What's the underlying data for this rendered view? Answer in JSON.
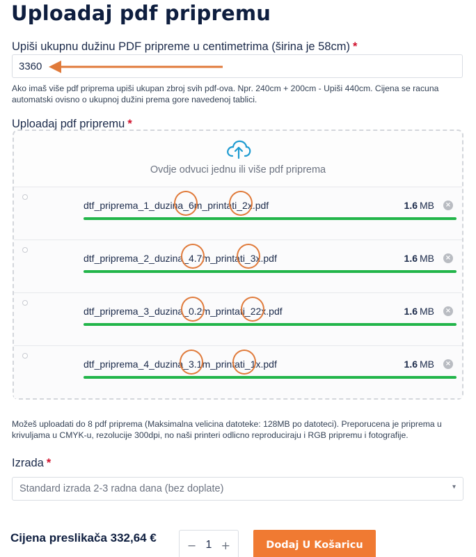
{
  "page_title": "Uploadaj pdf pripremu",
  "length_field": {
    "label": "Upiši ukupnu dužinu PDF pripreme u centimetrima (širina je 58cm)",
    "required_mark": "*",
    "value": "3360",
    "help": "Ako imaš više pdf priprema upiši ukupan zbroj svih pdf-ova. Npr. 240cm + 200cm - Upiši 440cm. Cijena se racuna automatski ovisno o ukupnoj dužini prema gore navedenoj tablici."
  },
  "upload_field": {
    "label": "Uploadaj pdf pripremu",
    "required_mark": "*",
    "dropzone_text": "Ovdje odvuci jednu ili više pdf priprema",
    "files": [
      {
        "name": "dtf_priprema_1_duzina_6m_printati_2x.pdf",
        "size_value": "1.6",
        "size_unit": "MB",
        "progress": 1.0
      },
      {
        "name": "dtf_priprema_2_duzina_4.7m_printati_3x.pdf",
        "size_value": "1.6",
        "size_unit": "MB",
        "progress": 1.0
      },
      {
        "name": "dtf_priprema_3_duzina_0.2m_printati_22x.pdf",
        "size_value": "1.6",
        "size_unit": "MB",
        "progress": 1.0
      },
      {
        "name": "dtf_priprema_4_duzina_3.1m_printati_1x.pdf",
        "size_value": "1.6",
        "size_unit": "MB",
        "progress": 1.0
      }
    ],
    "help": "Možeš uploadati do 8 pdf priprema (Maksimalna velicina datoteke: 128MB po datoteci). Preporucena je priprema u krivuljama u CMYK-u, rezolucije 300dpi, no naši printeri odlicno reproduciraju i RGB pripremu i fotografije."
  },
  "production_field": {
    "label": "Izrada",
    "required_mark": "*",
    "selected": "Standard izrada 2-3 radna dana (bez doplate)"
  },
  "footer": {
    "price_text": "Cijena preslikača 332,64 €",
    "qty_minus": "−",
    "qty_value": "1",
    "qty_plus": "+",
    "add_to_cart_label": "Dodaj U Košaricu"
  },
  "colors": {
    "accent_orange": "#f07a32",
    "annotation_orange": "#e07a3a",
    "progress_green": "#22b54a",
    "required_red": "#d0102b"
  }
}
